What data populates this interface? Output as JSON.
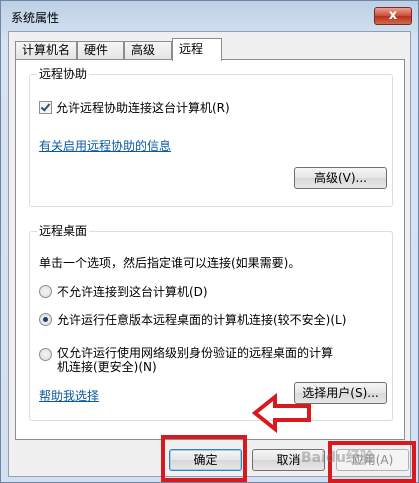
{
  "window": {
    "title": "系统属性",
    "close_glyph": "x"
  },
  "tabs": [
    {
      "label": "计算机名",
      "active": false
    },
    {
      "label": "硬件",
      "active": false
    },
    {
      "label": "高级",
      "active": false
    },
    {
      "label": "远程",
      "active": true
    }
  ],
  "remote_assistance": {
    "group_title": "远程协助",
    "allow_checkbox_label": "允许远程协助连接这台计算机(R)",
    "allow_checked": true,
    "info_link": "有关启用远程协助的信息",
    "advanced_button": "高级(V)..."
  },
  "remote_desktop": {
    "group_title": "远程桌面",
    "instruction": "单击一个选项，然后指定谁可以连接(如果需要)。",
    "options": [
      {
        "label": "不允许连接到这台计算机(D)",
        "selected": false
      },
      {
        "label": "允许运行任意版本远程桌面的计算机连接(较不安全)(L)",
        "selected": true
      },
      {
        "label_line1": "仅允许运行使用网络级别身份验证的远程桌面的计算",
        "label_line2": "机连接(更安全)(N)",
        "selected": false,
        "disabled": true
      }
    ],
    "help_link": "帮助我选择",
    "select_users_button": "选择用户(S)..."
  },
  "footer": {
    "ok_button": "确定",
    "cancel_button": "取消",
    "apply_button": "应用(A)"
  },
  "annotations": {
    "highlight_color": "#d8191d",
    "watermark": "Baidu经验"
  }
}
